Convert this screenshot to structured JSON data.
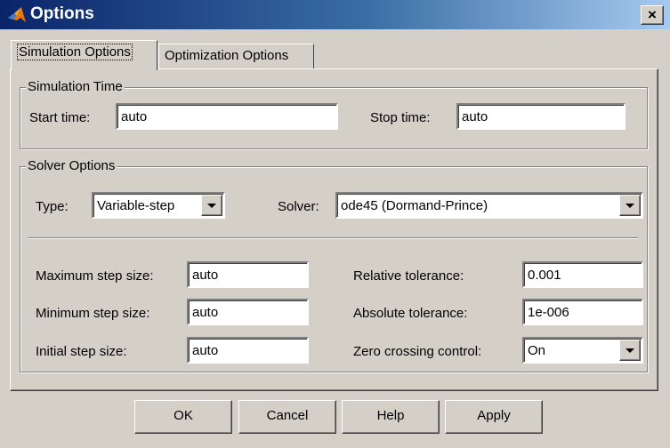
{
  "window": {
    "title": "Options",
    "close_glyph": "×",
    "icon": "matlab-logo-icon"
  },
  "tabs": [
    {
      "label": "Simulation Options",
      "active": true
    },
    {
      "label": "Optimization Options",
      "active": false
    }
  ],
  "simulation_time": {
    "title": "Simulation Time",
    "start_label": "Start time:",
    "start_value": "auto",
    "stop_label": "Stop time:",
    "stop_value": "auto"
  },
  "solver_options": {
    "title": "Solver Options",
    "type_label": "Type:",
    "type_value": "Variable-step",
    "solver_label": "Solver:",
    "solver_value": "ode45 (Dormand-Prince)",
    "max_step_label": "Maximum step size:",
    "max_step_value": "auto",
    "min_step_label": "Minimum step size:",
    "min_step_value": "auto",
    "init_step_label": "Initial step size:",
    "init_step_value": "auto",
    "rel_tol_label": "Relative tolerance:",
    "rel_tol_value": "0.001",
    "abs_tol_label": "Absolute tolerance:",
    "abs_tol_value": "1e-006",
    "zero_cross_label": "Zero crossing control:",
    "zero_cross_value": "On"
  },
  "buttons": {
    "ok": "OK",
    "cancel": "Cancel",
    "help": "Help",
    "apply": "Apply"
  },
  "colors": {
    "face": "#d4d0c8",
    "title_start": "#0a246a",
    "title_end": "#a6caf0"
  }
}
